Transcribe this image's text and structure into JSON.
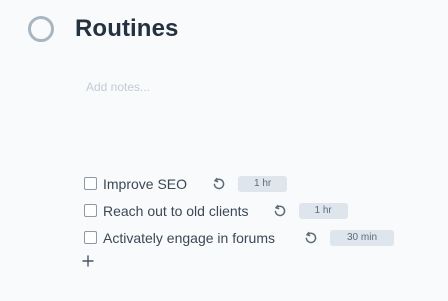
{
  "project": {
    "title": "Routines"
  },
  "notes": {
    "placeholder": "Add notes...",
    "value": ""
  },
  "tasks": [
    {
      "label": "Improve SEO",
      "checked": false,
      "repeat_icon": "repeat-icon",
      "duration": "1 hr"
    },
    {
      "label": "Reach out to old clients",
      "checked": false,
      "repeat_icon": "repeat-icon",
      "duration": "1 hr"
    },
    {
      "label": "Activately engage in forums",
      "checked": false,
      "repeat_icon": "repeat-icon",
      "duration": "30 min"
    }
  ],
  "add_task": {
    "icon": "plus-icon"
  },
  "colors": {
    "background": "#f8fafc",
    "project_circle": "#a9b6c1",
    "badge_bg": "#dfe5ed",
    "text": "#34414f",
    "placeholder": "#c2ccd5"
  }
}
